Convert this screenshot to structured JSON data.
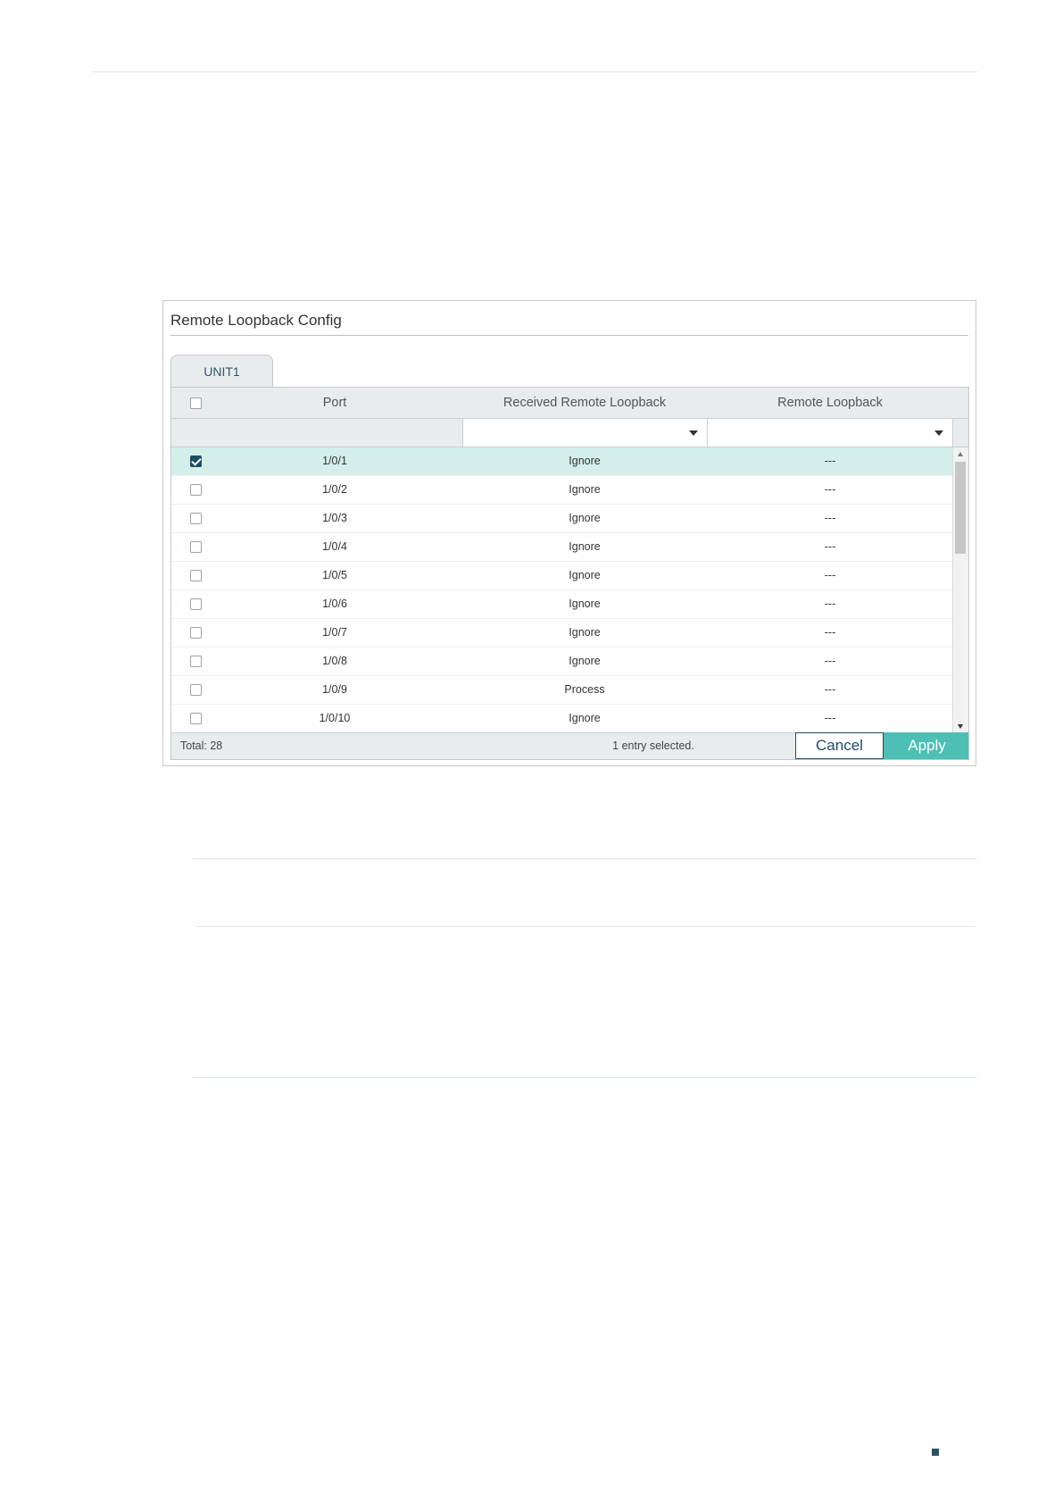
{
  "panel": {
    "title": "Remote Loopback Config",
    "tab_label": "UNIT1"
  },
  "table": {
    "headers": {
      "port": "Port",
      "received_remote_loopback": "Received Remote Loopback",
      "remote_loopback": "Remote Loopback"
    },
    "rows": [
      {
        "port": "1/0/1",
        "received": "Ignore",
        "remote": "---",
        "checked": true
      },
      {
        "port": "1/0/2",
        "received": "Ignore",
        "remote": "---",
        "checked": false
      },
      {
        "port": "1/0/3",
        "received": "Ignore",
        "remote": "---",
        "checked": false
      },
      {
        "port": "1/0/4",
        "received": "Ignore",
        "remote": "---",
        "checked": false
      },
      {
        "port": "1/0/5",
        "received": "Ignore",
        "remote": "---",
        "checked": false
      },
      {
        "port": "1/0/6",
        "received": "Ignore",
        "remote": "---",
        "checked": false
      },
      {
        "port": "1/0/7",
        "received": "Ignore",
        "remote": "---",
        "checked": false
      },
      {
        "port": "1/0/8",
        "received": "Ignore",
        "remote": "---",
        "checked": false
      },
      {
        "port": "1/0/9",
        "received": "Process",
        "remote": "---",
        "checked": false
      },
      {
        "port": "1/0/10",
        "received": "Ignore",
        "remote": "---",
        "checked": false
      }
    ],
    "selected_row_color": "#d4efea"
  },
  "footer": {
    "total": "Total: 28",
    "selection_info": "1 entry selected.",
    "cancel_label": "Cancel",
    "apply_label": "Apply"
  },
  "colors": {
    "accent": "#4dbfb5",
    "dark": "#1f4d61"
  }
}
